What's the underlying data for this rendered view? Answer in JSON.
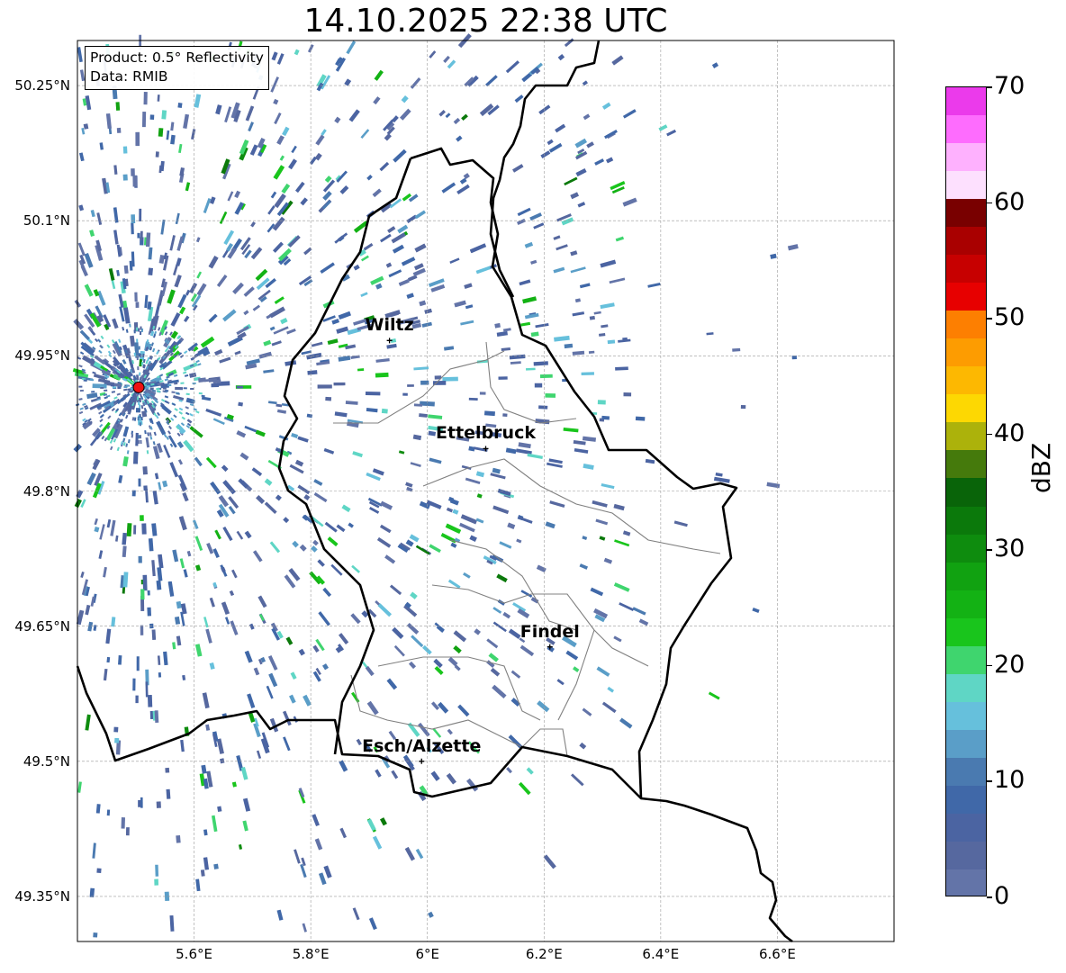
{
  "title": "14.10.2025 22:38 UTC",
  "info": {
    "product": "Product: 0.5° Reflectivity",
    "source": "Data: RMIB"
  },
  "map": {
    "lon_range": [
      5.4,
      6.8
    ],
    "lat_range": [
      49.3,
      50.3
    ],
    "grid": true,
    "lat_ticks": [
      {
        "value": 50.25,
        "label": "50.25°N"
      },
      {
        "value": 50.1,
        "label": "50.1°N"
      },
      {
        "value": 49.95,
        "label": "49.95°N"
      },
      {
        "value": 49.8,
        "label": "49.8°N"
      },
      {
        "value": 49.65,
        "label": "49.65°N"
      },
      {
        "value": 49.5,
        "label": "49.5°N"
      },
      {
        "value": 49.35,
        "label": "49.35°N"
      }
    ],
    "lon_ticks": [
      {
        "value": 5.6,
        "label": "5.6°E"
      },
      {
        "value": 5.8,
        "label": "5.8°E"
      },
      {
        "value": 6.0,
        "label": "6°E"
      },
      {
        "value": 6.2,
        "label": "6.2°E"
      },
      {
        "value": 6.4,
        "label": "6.4°E"
      },
      {
        "value": 6.6,
        "label": "6.6°E"
      }
    ],
    "radar_site": {
      "lon": 5.505,
      "lat": 49.915,
      "color": "#ee1111"
    },
    "cities": [
      {
        "name": "Wiltz",
        "lon": 5.935,
        "lat": 49.967
      },
      {
        "name": "Ettelbruck",
        "lon": 6.1,
        "lat": 49.847
      },
      {
        "name": "Findel",
        "lon": 6.21,
        "lat": 49.627
      },
      {
        "name": "Esch/Alzette",
        "lon": 5.99,
        "lat": 49.5
      }
    ],
    "border_color": "#000000",
    "canton_color": "#808080"
  },
  "colorbar": {
    "label": "dBZ",
    "min": 0,
    "max": 70,
    "ticks": [
      {
        "value": 0,
        "label": "0"
      },
      {
        "value": 10,
        "label": "10"
      },
      {
        "value": 20,
        "label": "20"
      },
      {
        "value": 30,
        "label": "30"
      },
      {
        "value": 40,
        "label": "40"
      },
      {
        "value": 50,
        "label": "50"
      },
      {
        "value": 60,
        "label": "60"
      },
      {
        "value": 70,
        "label": "70"
      }
    ],
    "colors": [
      "#6374a8",
      "#56689f",
      "#4b64a2",
      "#4068a8",
      "#4a7ab0",
      "#5a9ec8",
      "#66c0dc",
      "#5fd6c5",
      "#3fd56e",
      "#19c51c",
      "#13b214",
      "#11a211",
      "#0e8c0e",
      "#0b790b",
      "#096409",
      "#457a0c",
      "#acb20b",
      "#fdd802",
      "#fdb801",
      "#fd9c01",
      "#fd7f01",
      "#e70000",
      "#c70000",
      "#a90000",
      "#790000",
      "#fde0fe",
      "#feb1fe",
      "#fe6cfe",
      "#eb3aeb"
    ]
  }
}
